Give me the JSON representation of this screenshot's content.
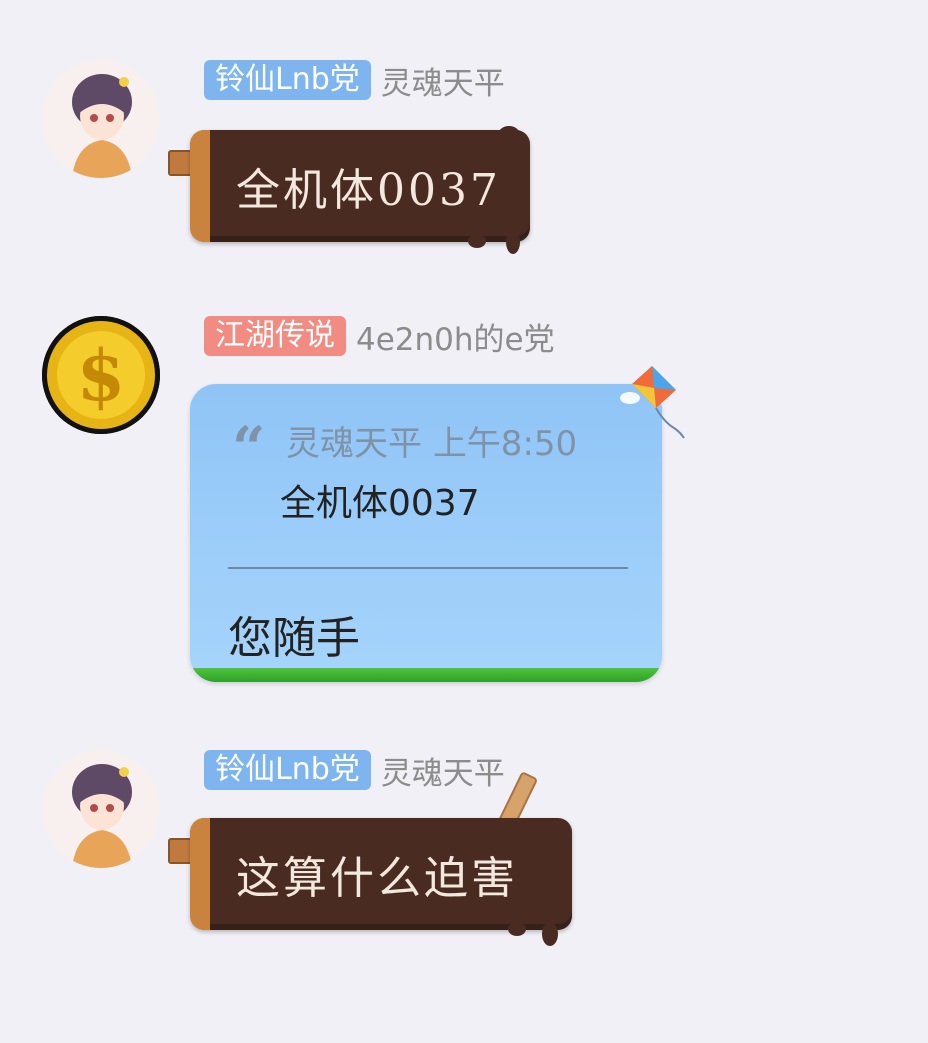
{
  "messages": [
    {
      "badge": "铃仙Lnb党",
      "badge_color": "#7fb5ee",
      "sender": "灵魂天平",
      "text": "全机体0037",
      "avatar": "anime-girl-avatar"
    },
    {
      "badge": "江湖传说",
      "badge_color": "#f28b82",
      "sender": "4e2n0h的e党",
      "avatar": "dollar-coin-avatar",
      "quote": {
        "author": "灵魂天平",
        "time": "上午8:50",
        "text": "全机体0037"
      },
      "text": "您随手"
    },
    {
      "badge": "铃仙Lnb党",
      "badge_color": "#7fb5ee",
      "sender": "灵魂天平",
      "text": "这算什么迫害",
      "avatar": "anime-girl-avatar"
    }
  ],
  "icons": {
    "quote": "quote-icon",
    "kite": "kite-icon"
  },
  "colors": {
    "background": "#f0f0f6",
    "chocolate": "#4a2b22",
    "stick": "#c9833f",
    "bubble_blue": "#9ccdfa"
  }
}
